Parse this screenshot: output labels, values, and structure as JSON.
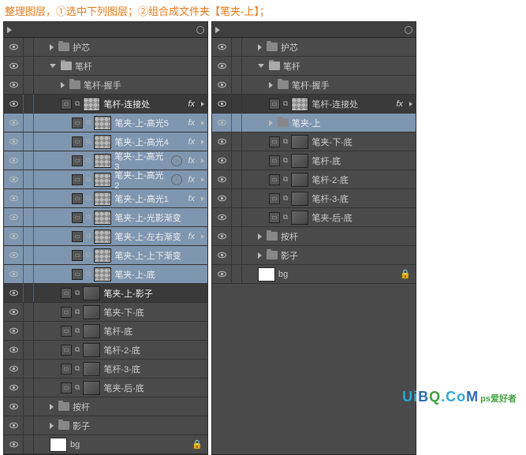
{
  "instruction": "整理图层，①选中下列图层；②组合成文件夹【笔夹-上】；",
  "footer": {
    "brand": "UiBQ.CoM",
    "suffix": "ps爱好者"
  },
  "common": {
    "fx": "fx"
  },
  "panelA": {
    "rows": [
      {
        "label": "护芯",
        "kind": "folder-closed",
        "indent": 1
      },
      {
        "label": "笔杆",
        "kind": "folder-open",
        "indent": 1
      },
      {
        "label": "笔杆-握手",
        "kind": "folder-closed",
        "indent": 2
      },
      {
        "label": "笔杆-连接处",
        "kind": "shape",
        "indent": 2,
        "fx": true,
        "sel": true,
        "dark": true
      },
      {
        "label": "笔夹-上-高光5",
        "kind": "shape",
        "indent": 3,
        "fx": true,
        "sel": true
      },
      {
        "label": "笔夹-上-高光4",
        "kind": "shape",
        "indent": 3,
        "fx": true,
        "sel": true
      },
      {
        "label": "笔夹-上-高光3",
        "kind": "shape",
        "indent": 3,
        "fx": true,
        "sel": true,
        "extra": true
      },
      {
        "label": "笔夹-上-高光2",
        "kind": "shape",
        "indent": 3,
        "fx": true,
        "sel": true,
        "extra": true
      },
      {
        "label": "笔夹-上-高光1",
        "kind": "shape",
        "indent": 3,
        "fx": true,
        "sel": true
      },
      {
        "label": "笔夹-上-光影渐变",
        "kind": "shape",
        "indent": 3,
        "sel": true
      },
      {
        "label": "笔夹-上-左右渐变",
        "kind": "shape",
        "indent": 3,
        "fx": true,
        "sel": true
      },
      {
        "label": "笔夹-上-上下渐变",
        "kind": "shape",
        "indent": 3,
        "sel": true
      },
      {
        "label": "笔夹-上-底",
        "kind": "shape",
        "indent": 3,
        "sel": true,
        "sel2": true
      },
      {
        "label": "笔夹-上-影子",
        "kind": "shape-mask",
        "indent": 2,
        "sel": true,
        "dark": true
      },
      {
        "label": "笔夹-下-底",
        "kind": "shape-mask",
        "indent": 2
      },
      {
        "label": "笔杆-底",
        "kind": "shape-mask",
        "indent": 2
      },
      {
        "label": "笔杆-2-底",
        "kind": "shape-mask",
        "indent": 2
      },
      {
        "label": "笔杆-3-底",
        "kind": "shape-mask",
        "indent": 2
      },
      {
        "label": "笔夹-后-底",
        "kind": "shape-mask",
        "indent": 2
      },
      {
        "label": "按杆",
        "kind": "folder-closed",
        "indent": 1
      },
      {
        "label": "影子",
        "kind": "folder-closed",
        "indent": 1
      },
      {
        "label": "bg",
        "kind": "bg",
        "indent": 1,
        "lock": true
      }
    ]
  },
  "panelB": {
    "rows": [
      {
        "label": "护芯",
        "kind": "folder-closed",
        "indent": 1
      },
      {
        "label": "笔杆",
        "kind": "folder-open",
        "indent": 1
      },
      {
        "label": "笔杆-握手",
        "kind": "folder-closed",
        "indent": 2
      },
      {
        "label": "笔杆-连接处",
        "kind": "shape",
        "indent": 2,
        "fx": true,
        "dark": true
      },
      {
        "label": "笔夹-上",
        "kind": "folder-closed",
        "indent": 2,
        "sel": true
      },
      {
        "label": "笔夹-下-底",
        "kind": "shape-mask",
        "indent": 2
      },
      {
        "label": "笔杆-底",
        "kind": "shape-mask",
        "indent": 2
      },
      {
        "label": "笔杆-2-底",
        "kind": "shape-mask",
        "indent": 2
      },
      {
        "label": "笔杆-3-底",
        "kind": "shape-mask",
        "indent": 2
      },
      {
        "label": "笔夹-后-底",
        "kind": "shape-mask",
        "indent": 2
      },
      {
        "label": "按杆",
        "kind": "folder-closed",
        "indent": 1
      },
      {
        "label": "影子",
        "kind": "folder-closed",
        "indent": 1
      },
      {
        "label": "bg",
        "kind": "bg",
        "indent": 1,
        "lock": true
      }
    ]
  }
}
